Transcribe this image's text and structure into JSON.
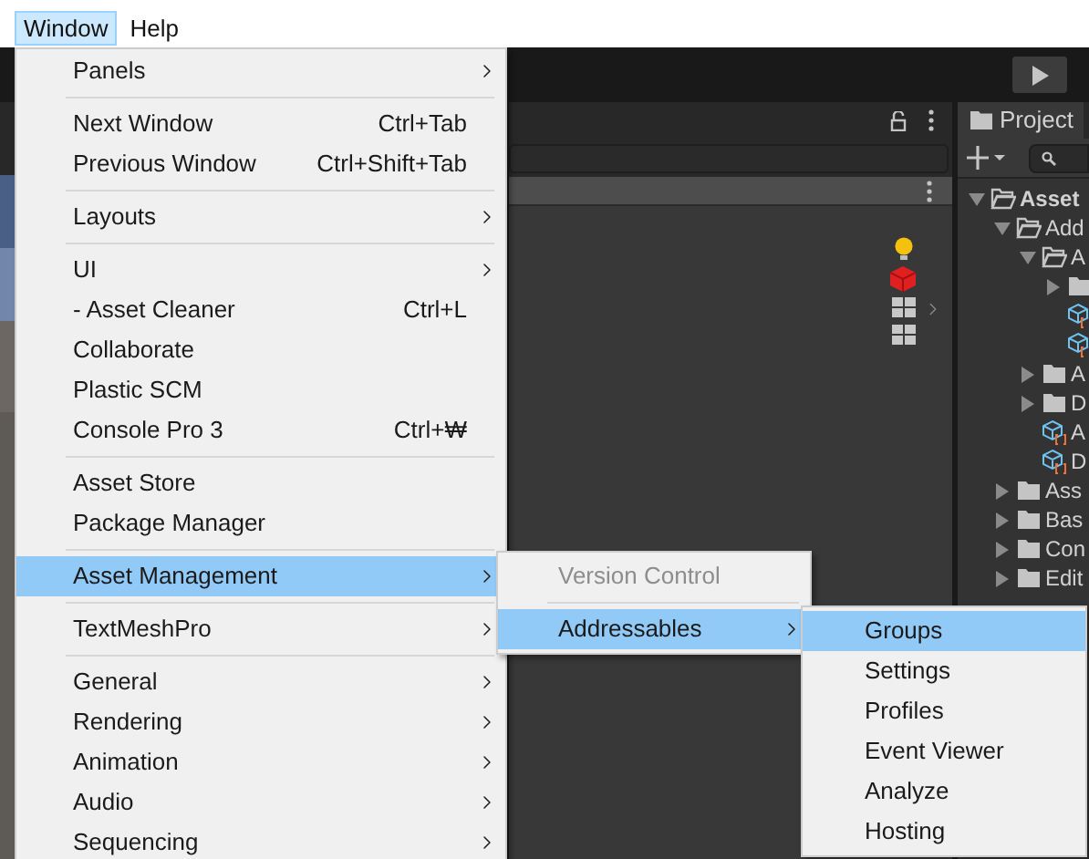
{
  "menu_bar": [
    {
      "label": "Window",
      "selected": true
    },
    {
      "label": "Help",
      "selected": false
    }
  ],
  "window_menu": [
    {
      "kind": "item",
      "label": "Panels",
      "submenu": true,
      "selected": false
    },
    {
      "kind": "separator"
    },
    {
      "kind": "item",
      "label": "Next Window",
      "shortcut": "Ctrl+Tab",
      "selected": false
    },
    {
      "kind": "item",
      "label": "Previous Window",
      "shortcut": "Ctrl+Shift+Tab",
      "selected": false
    },
    {
      "kind": "separator"
    },
    {
      "kind": "item",
      "label": "Layouts",
      "submenu": true,
      "selected": false
    },
    {
      "kind": "separator"
    },
    {
      "kind": "item",
      "label": "UI",
      "submenu": true,
      "selected": false
    },
    {
      "kind": "item",
      "label": "- Asset Cleaner",
      "shortcut": "Ctrl+L",
      "selected": false
    },
    {
      "kind": "item",
      "label": "Collaborate",
      "selected": false
    },
    {
      "kind": "item",
      "label": "Plastic SCM",
      "selected": false
    },
    {
      "kind": "item",
      "label": "Console Pro 3",
      "shortcut": "Ctrl+₩",
      "selected": false
    },
    {
      "kind": "separator"
    },
    {
      "kind": "item",
      "label": "Asset Store",
      "selected": false
    },
    {
      "kind": "item",
      "label": "Package Manager",
      "selected": false
    },
    {
      "kind": "separator"
    },
    {
      "kind": "item",
      "label": "Asset Management",
      "submenu": true,
      "selected": true
    },
    {
      "kind": "separator"
    },
    {
      "kind": "item",
      "label": "TextMeshPro",
      "submenu": true,
      "selected": false
    },
    {
      "kind": "separator"
    },
    {
      "kind": "item",
      "label": "General",
      "submenu": true,
      "selected": false
    },
    {
      "kind": "item",
      "label": "Rendering",
      "submenu": true,
      "selected": false
    },
    {
      "kind": "item",
      "label": "Animation",
      "submenu": true,
      "selected": false
    },
    {
      "kind": "item",
      "label": "Audio",
      "submenu": true,
      "selected": false
    },
    {
      "kind": "item",
      "label": "Sequencing",
      "submenu": true,
      "selected": false
    }
  ],
  "asset_management_menu": [
    {
      "kind": "item",
      "label": "Version Control",
      "disabled": true,
      "selected": false
    },
    {
      "kind": "separator"
    },
    {
      "kind": "item",
      "label": "Addressables",
      "submenu": true,
      "selected": true
    }
  ],
  "addressables_menu": [
    {
      "kind": "item",
      "label": "Groups",
      "selected": true
    },
    {
      "kind": "item",
      "label": "Settings",
      "selected": false
    },
    {
      "kind": "item",
      "label": "Profiles",
      "selected": false
    },
    {
      "kind": "item",
      "label": "Event Viewer",
      "selected": false
    },
    {
      "kind": "item",
      "label": "Analyze",
      "selected": false
    },
    {
      "kind": "item",
      "label": "Hosting",
      "selected": false
    }
  ],
  "project_panel": {
    "tab": "Project",
    "tree": [
      {
        "kind": "folder",
        "label": "Asset",
        "expanded": true,
        "children": [
          {
            "kind": "folder",
            "label": "Add",
            "expanded": true,
            "children": [
              {
                "kind": "folder",
                "label": "A",
                "expanded": true,
                "children": [
                  {
                    "kind": "folder",
                    "expanded": false
                  },
                  {
                    "kind": "asset"
                  },
                  {
                    "kind": "asset"
                  }
                ]
              },
              {
                "kind": "folder",
                "label": "A",
                "expanded": false
              },
              {
                "kind": "folder",
                "label": "D",
                "expanded": false
              },
              {
                "kind": "asset",
                "label": "A"
              },
              {
                "kind": "asset",
                "label": "D"
              }
            ]
          },
          {
            "kind": "folder",
            "label": "Ass",
            "expanded": false
          },
          {
            "kind": "folder",
            "label": "Bas",
            "expanded": false
          },
          {
            "kind": "folder",
            "label": "Con",
            "expanded": false
          },
          {
            "kind": "folder",
            "label": "Edit",
            "expanded": false
          }
        ]
      }
    ]
  }
}
